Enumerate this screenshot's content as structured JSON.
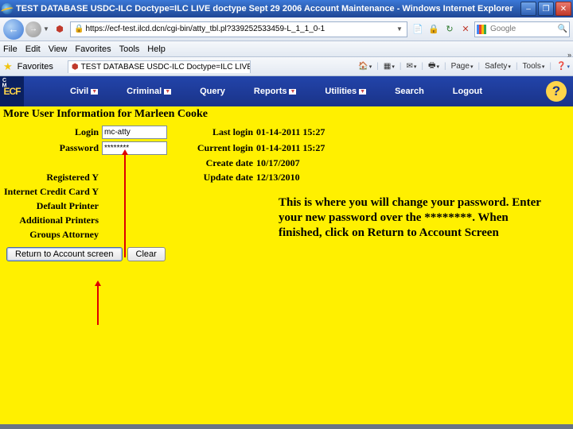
{
  "window": {
    "title": "TEST DATABASE USDC-ILC Doctype=ILC LIVE doctype Sept 29 2006 Account Maintenance - Windows Internet Explorer",
    "tab_title": "TEST DATABASE USDC-ILC Doctype=ILC LIVE docty…",
    "url": "https://ecf-test.ilcd.dcn/cgi-bin/atty_tbl.pl?339252533459-L_1_1_0-1",
    "search_placeholder": "Google"
  },
  "menubar": {
    "file": "File",
    "edit": "Edit",
    "view": "View",
    "favorites": "Favorites",
    "tools": "Tools",
    "help": "Help"
  },
  "favbar": {
    "favorites": "Favorites"
  },
  "ie_tools": {
    "page": "Page",
    "safety": "Safety",
    "tools": "Tools"
  },
  "ecf_nav": {
    "civil": "Civil",
    "criminal": "Criminal",
    "query": "Query",
    "reports": "Reports",
    "utilities": "Utilities",
    "search": "Search",
    "logout": "Logout"
  },
  "page": {
    "heading": "More User Information for Marleen Cooke",
    "labels": {
      "login": "Login",
      "password": "Password",
      "registered": "Registered",
      "icc": "Internet Credit Card",
      "default_printer": "Default Printer",
      "additional_printers": "Additional Printers",
      "groups": "Groups",
      "last_login": "Last login",
      "current_login": "Current login",
      "create_date": "Create date",
      "update_date": "Update date"
    },
    "values": {
      "login": "mc-atty",
      "password": "********",
      "registered": "Y",
      "icc": "Y",
      "default_printer": "",
      "additional_printers": "",
      "groups": "Attorney",
      "last_login": "01-14-2011 15:27",
      "current_login": "01-14-2011 15:27",
      "create_date": "10/17/2007",
      "update_date": "12/13/2010"
    },
    "buttons": {
      "return": "Return to Account screen",
      "clear": "Clear"
    }
  },
  "callout": "This is where you will change your password. Enter your new password over the ********. When finished, click on Return to Account Screen"
}
